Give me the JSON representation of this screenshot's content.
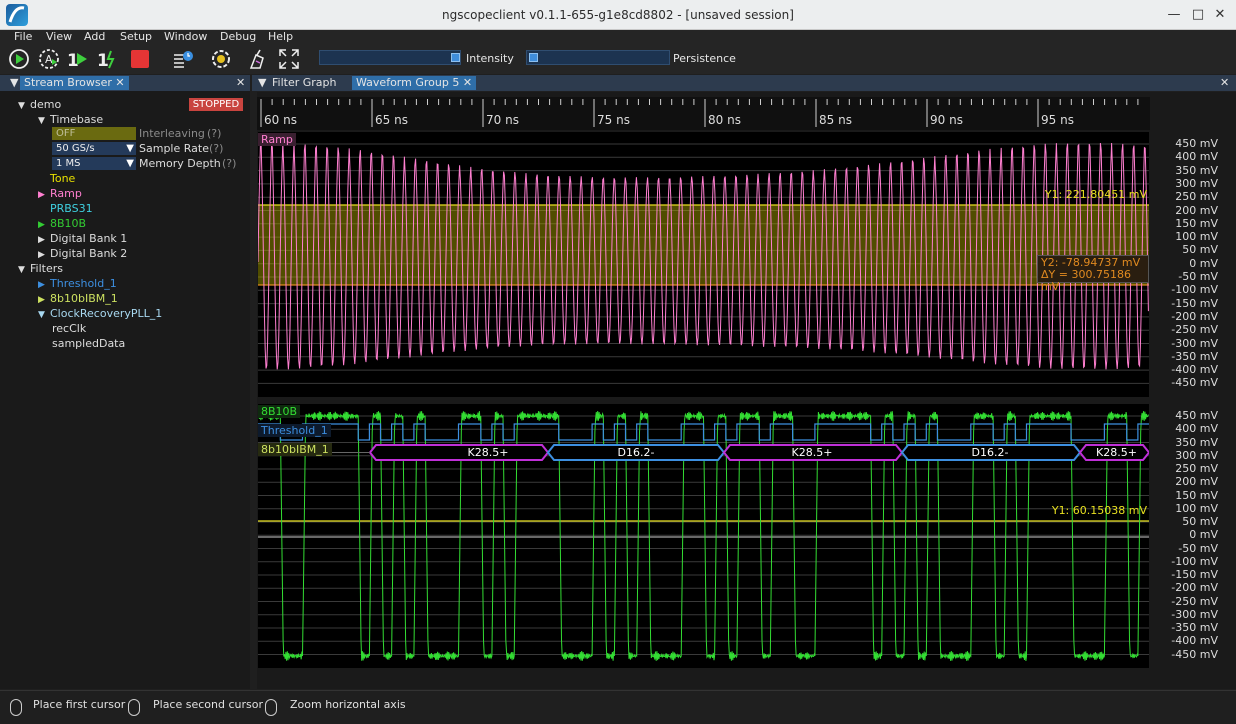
{
  "window": {
    "title": "ngscopeclient v0.1.1-655-g1e8cd8802  - [unsaved session]"
  },
  "menu": [
    "File",
    "View",
    "Add",
    "Setup",
    "Window",
    "Debug",
    "Help"
  ],
  "toolbar": {
    "intensity_label": "Intensity",
    "persistence_label": "Persistence",
    "intensity_level": 0.7,
    "persistence_level": 0.03
  },
  "stream_browser": {
    "tab": "Stream Browser",
    "instrument": "demo",
    "status": "STOPPED",
    "timebase": "Timebase",
    "interleaving_value": "OFF",
    "interleaving_label": "Interleaving",
    "sample_rate_value": "50 GS/s",
    "sample_rate_label": "Sample Rate",
    "memory_depth_value": "1 MS",
    "memory_depth_label": "Memory Depth",
    "help": "(?)",
    "channels": [
      "Tone",
      "Ramp",
      "PRBS31",
      "8B10B",
      "Digital Bank 1",
      "Digital Bank 2"
    ],
    "filters_label": "Filters",
    "filters": [
      "Threshold_1",
      "8b10bIBM_1",
      "ClockRecoveryPLL_1"
    ],
    "pll_outputs": [
      "recClk",
      "sampledData"
    ]
  },
  "tabs": {
    "filter_graph": "Filter Graph",
    "waveform_group": "Waveform Group 5"
  },
  "time_axis": [
    "60 ns",
    "65 ns",
    "70 ns",
    "75 ns",
    "80 ns",
    "85 ns",
    "90 ns",
    "95 ns"
  ],
  "plot1": {
    "channel": "Ramp",
    "y_labels": [
      "450 mV",
      "400 mV",
      "350 mV",
      "300 mV",
      "250 mV",
      "200 mV",
      "150 mV",
      "100 mV",
      "50 mV",
      "0 mV",
      "-50 mV",
      "-100 mV",
      "-150 mV",
      "-200 mV",
      "-250 mV",
      "-300 mV",
      "-350 mV",
      "-400 mV",
      "-450 mV"
    ],
    "cursor1": "Y1: 221.80451 mV",
    "cursor2": "Y2: -78.94737 mV",
    "delta": "ΔY = 300.75186 mV"
  },
  "plot2": {
    "channels": [
      "8B10B",
      "Threshold_1",
      "8b10bIBM_1"
    ],
    "y_labels": [
      "450 mV",
      "400 mV",
      "350 mV",
      "300 mV",
      "250 mV",
      "200 mV",
      "150 mV",
      "100 mV",
      "50 mV",
      "0 mV",
      "-50 mV",
      "-100 mV",
      "-150 mV",
      "-200 mV",
      "-250 mV",
      "-300 mV",
      "-350 mV",
      "-400 mV",
      "-450 mV"
    ],
    "cursor1": "Y1: 60.15038 mV",
    "symbols": [
      "K28.5+",
      "D16.2-",
      "K28.5+",
      "D16.2-",
      "K28.5+"
    ]
  },
  "status": {
    "first": "Place first cursor",
    "second": "Place second cursor",
    "zoom": "Zoom horizontal axis"
  },
  "colors": {
    "ramp": "#ff7fd0",
    "green": "#33dd33",
    "threshold": "#3d8fe0",
    "decode": "#c030d8",
    "cursor": "#e8e020",
    "cursor2": "#e08a20"
  }
}
